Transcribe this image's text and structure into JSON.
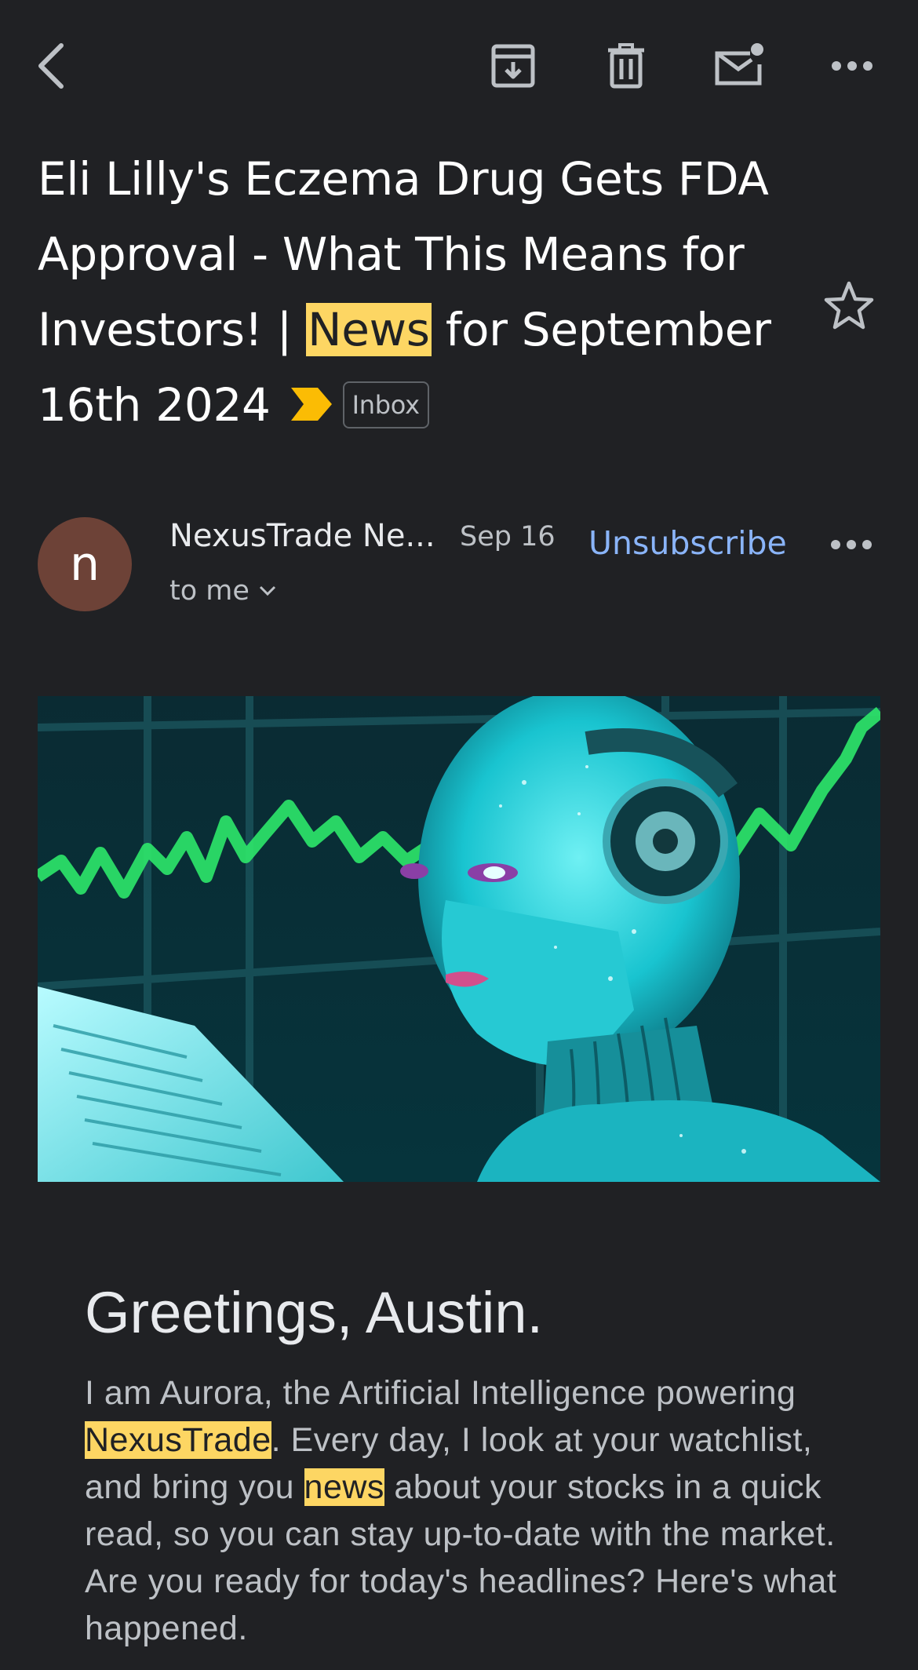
{
  "toolbar": {
    "back_icon": "chevron-left-icon",
    "archive_icon": "archive-icon",
    "delete_icon": "trash-icon",
    "mark_unread_icon": "mail-unread-icon",
    "more_icon": "more-horizontal-icon"
  },
  "email": {
    "subject_part1": "Eli Lilly's Eczema Drug Gets FDA Approval - What This Means for Investors! | ",
    "subject_highlight": "News",
    "subject_part2": " for September 16th 2024",
    "label": "Inbox",
    "importance_color": "#fbbc04",
    "starred": false
  },
  "sender": {
    "initial": "n",
    "avatar_color": "#6d4237",
    "name": "NexusTrade Ne...",
    "date": "Sep 16",
    "recipient": "to me",
    "unsubscribe_label": "Unsubscribe"
  },
  "body": {
    "greeting": "Greetings, Austin.",
    "p1": "I am Aurora, the Artificial Intelligence powering ",
    "hl1": "NexusTrade",
    "p2": ". Every day, I look at your watchlist, and bring you ",
    "hl2": "news",
    "p3": " about your stocks in a quick read, so you can stay up-to-date with the market. Are you ready for today's headlines? Here's what happened."
  },
  "colors": {
    "background": "#202124",
    "link": "#8ab4f8",
    "highlight": "#fdd663"
  }
}
